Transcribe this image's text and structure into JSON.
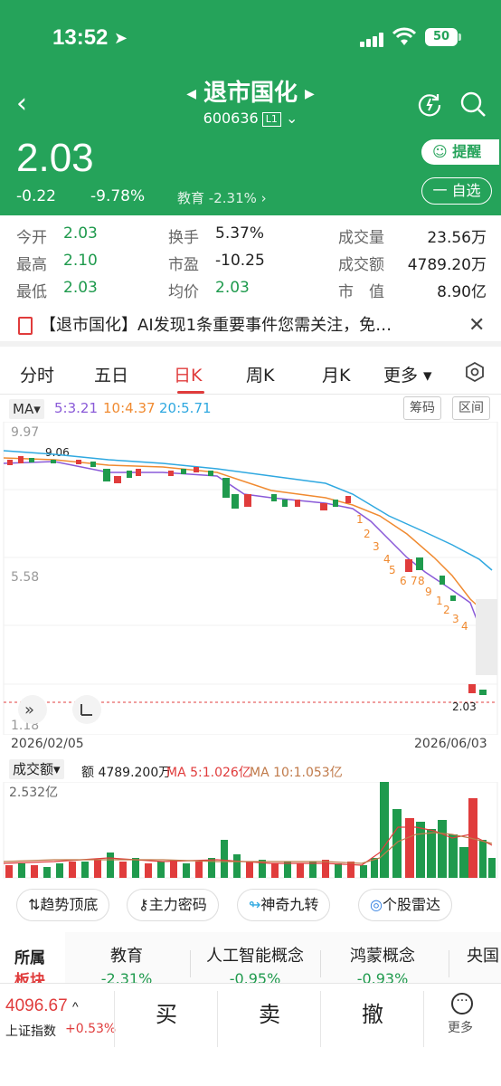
{
  "status": {
    "time": "13:52",
    "battery": "50"
  },
  "header": {
    "title": "退市国化",
    "code": "600636",
    "code_badge": "L1"
  },
  "quote": {
    "price": "2.03",
    "change": "-0.22",
    "change_pct": "-9.78%",
    "sector_name": "教育",
    "sector_pct": "-2.31%",
    "remind_label": "提醒",
    "watchlist_label": "一 自选"
  },
  "stats": [
    {
      "label": "今开",
      "value": "2.03"
    },
    {
      "label": "最高",
      "value": "2.10"
    },
    {
      "label": "最低",
      "value": "2.03"
    },
    {
      "label": "换手",
      "value": "5.37%"
    },
    {
      "label": "市盈",
      "value": "-10.25"
    },
    {
      "label": "均价",
      "value": "2.03"
    },
    {
      "label": "成交量",
      "value": "23.56万"
    },
    {
      "label": "成交额",
      "value": "4789.20万"
    },
    {
      "label": "市　值",
      "value": "8.90亿"
    }
  ],
  "notice": {
    "text": "【退市国化】AI发现1条重要事件您需关注，免…",
    "close": "✕"
  },
  "tabs": [
    "分时",
    "五日",
    "日K",
    "周K",
    "月K",
    "更多 ▾"
  ],
  "ma": {
    "badge": "MA▾",
    "ma5": "5:3.21",
    "ma10": "10:4.37",
    "ma20": "20:5.71",
    "chip_btn": "筹码",
    "range_btn": "区间"
  },
  "chart_labels": {
    "high_axis": "9.97",
    "mid_axis": "5.58",
    "low_axis": "1.18",
    "peak": "9.06",
    "last": "2.03",
    "start_date": "2026/02/05",
    "end_date": "2026/06/03"
  },
  "volume": {
    "badge": "成交额▾",
    "amount": "额 4789.200万",
    "ma5": "MA 5:1.026亿",
    "ma10": "MA 10:1.053亿",
    "axis_max": "2.532亿"
  },
  "features": [
    "⇅趋势顶底",
    "主力密码",
    "神奇九转",
    "个股雷达"
  ],
  "sectors": {
    "head": "所属",
    "head_sub": "板块",
    "items": [
      {
        "name": "教育",
        "pct": "-2.31%"
      },
      {
        "name": "人工智能概念",
        "pct": "-0.95%"
      },
      {
        "name": "鸿蒙概念",
        "pct": "-0.93%"
      },
      {
        "name": "央国",
        "pct": ""
      }
    ]
  },
  "bottom": {
    "index_value": "4096.67",
    "index_name": "上证指数",
    "index_pct": "+0.53%",
    "buy": "买",
    "sell": "卖",
    "cancel": "撤",
    "more": "更多"
  },
  "colors": {
    "brand_green": "#25a35a",
    "up_red": "#e03c3c",
    "down_green": "#1f9a4d"
  },
  "chart_data": {
    "type": "candlestick",
    "y_axis_ticks": [
      9.97,
      5.58,
      1.18
    ],
    "x_range": [
      "2026/02/05",
      "2026/06/03"
    ],
    "ma_lines": {
      "MA5": 3.21,
      "MA10": 4.37,
      "MA20": 5.71
    },
    "last_close": 2.03,
    "period_high": 9.06,
    "volume_axis_max": "2.532亿"
  }
}
